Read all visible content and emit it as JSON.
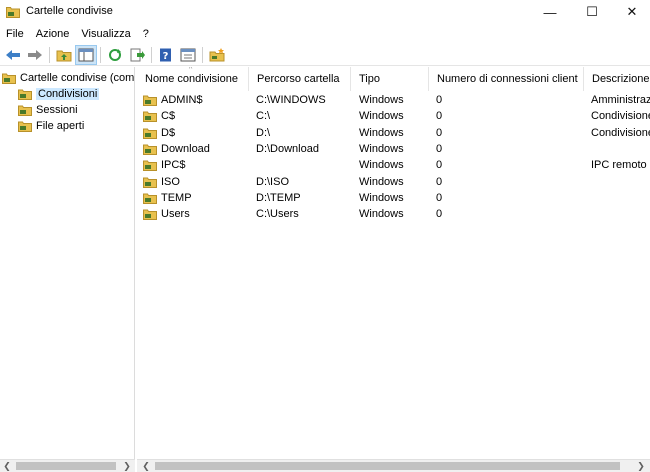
{
  "window": {
    "title": "Cartelle condivise",
    "minimize": "—",
    "maximize": "☐",
    "close": "✕"
  },
  "menu": [
    "File",
    "Azione",
    "Visualizza",
    "?"
  ],
  "toolbar": {
    "buttons": [
      "back-icon",
      "forward-icon",
      "up-folder-icon",
      "show-hide-tree-icon",
      "refresh-icon",
      "export-list-icon",
      "help-icon",
      "properties-icon",
      "new-share-icon"
    ]
  },
  "tree": {
    "root": "Cartelle condivise (comp",
    "items": [
      "Condivisioni",
      "Sessioni",
      "File aperti"
    ],
    "selected": "Condivisioni"
  },
  "table": {
    "columns": [
      "Nome condivisione",
      "Percorso cartella",
      "Tipo",
      "Numero di connessioni client",
      "Descrizione"
    ],
    "rows": [
      {
        "name": "ADMIN$",
        "path": "C:\\WINDOWS",
        "type": "Windows",
        "connections": "0",
        "description": "Amministrazi"
      },
      {
        "name": "C$",
        "path": "C:\\",
        "type": "Windows",
        "connections": "0",
        "description": "Condivisione"
      },
      {
        "name": "D$",
        "path": "D:\\",
        "type": "Windows",
        "connections": "0",
        "description": "Condivisione"
      },
      {
        "name": "Download",
        "path": "D:\\Download",
        "type": "Windows",
        "connections": "0",
        "description": ""
      },
      {
        "name": "IPC$",
        "path": "",
        "type": "Windows",
        "connections": "0",
        "description": "IPC remoto"
      },
      {
        "name": "ISO",
        "path": "D:\\ISO",
        "type": "Windows",
        "connections": "0",
        "description": ""
      },
      {
        "name": "TEMP",
        "path": "D:\\TEMP",
        "type": "Windows",
        "connections": "0",
        "description": ""
      },
      {
        "name": "Users",
        "path": "C:\\Users",
        "type": "Windows",
        "connections": "0",
        "description": ""
      }
    ]
  },
  "colors": {
    "selection": "#cce8ff",
    "folder": "#e8c14e",
    "folder_dark": "#b8912a",
    "share_hand": "#4a7a2a"
  }
}
